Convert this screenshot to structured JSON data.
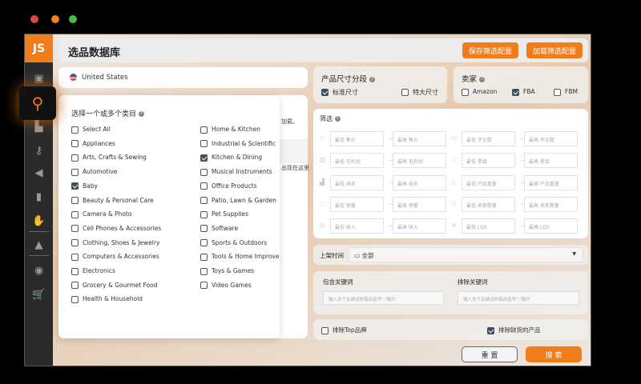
{
  "window": {
    "controls": {
      "close": "#e0443e",
      "minimize": "#f0811e",
      "maximize": "#4cb84c"
    }
  },
  "logo": "JS",
  "sidebar": {
    "icons": [
      "briefcase-icon",
      "search-icon",
      "factory-icon",
      "key-icon",
      "megaphone-icon",
      "bar-chart-icon",
      "hand-gift-icon",
      "graduation-cap-icon",
      "chrome-icon",
      "cart-icon"
    ],
    "active": "search-icon"
  },
  "header": {
    "title": "选品数据库",
    "save_label": "保存筛选配置",
    "load_label": "加载筛选配置"
  },
  "country": {
    "flag": "us-flag-icon",
    "value": "United States"
  },
  "background_text": {
    "line1": "加载。",
    "line2": "出现在这里"
  },
  "categories": {
    "title": "选择一个或多个类目",
    "left": [
      {
        "label": "Select All",
        "checked": false
      },
      {
        "label": "Appliances",
        "checked": false
      },
      {
        "label": "Arts, Crafts & Sewing",
        "checked": false
      },
      {
        "label": "Automotive",
        "checked": false
      },
      {
        "label": "Baby",
        "checked": true
      },
      {
        "label": "Beauty & Personal Care",
        "checked": false
      },
      {
        "label": "Camera & Photo",
        "checked": false
      },
      {
        "label": "Cell Phones & Accessories",
        "checked": false
      },
      {
        "label": "Clothing, Shoes & Jewelry",
        "checked": false
      },
      {
        "label": "Computers & Accessories",
        "checked": false
      },
      {
        "label": "Electronics",
        "checked": false
      },
      {
        "label": "Grocery & Gourmet Food",
        "checked": false
      },
      {
        "label": "Health & Household",
        "checked": false
      }
    ],
    "right": [
      {
        "label": "Home & Kitchen",
        "checked": false
      },
      {
        "label": "Industrial & Scientific",
        "checked": false
      },
      {
        "label": "Kitchen & Dining",
        "checked": true
      },
      {
        "label": "Musical Instruments",
        "checked": false
      },
      {
        "label": "Office Products",
        "checked": false
      },
      {
        "label": "Patio, Lawn & Garden",
        "checked": false
      },
      {
        "label": "Pet Supplies",
        "checked": false
      },
      {
        "label": "Software",
        "checked": false
      },
      {
        "label": "Sports & Outdoors",
        "checked": false
      },
      {
        "label": "Tools & Home Improvement",
        "checked": false
      },
      {
        "label": "Toys & Games",
        "checked": false
      },
      {
        "label": "Video Games",
        "checked": false
      }
    ]
  },
  "size": {
    "title": "产品尺寸分段",
    "options": [
      {
        "label": "标准尺寸",
        "checked": true
      },
      {
        "label": "特大尺寸",
        "checked": false
      }
    ]
  },
  "seller": {
    "title": "卖家",
    "options": [
      {
        "label": "Amazon",
        "checked": false
      },
      {
        "label": "FBA",
        "checked": true
      },
      {
        "label": "FBM",
        "checked": false
      }
    ]
  },
  "filters": {
    "title": "筛选",
    "rows": [
      {
        "icon": "tag-icon",
        "min": "最低 售价",
        "max": "最高 售价"
      },
      {
        "icon": "comment-icon",
        "min": "最低 评论数",
        "max": "最高 评论数"
      },
      {
        "icon": "money-bag-icon",
        "min": "最低 毛利润",
        "max": "最高 毛利润"
      },
      {
        "icon": "star-icon",
        "min": "最低 星级",
        "max": "最高 星级"
      },
      {
        "icon": "rank-icon",
        "min": "最低 排名",
        "max": "最高 排名"
      },
      {
        "icon": "weight-icon",
        "min": "最低 产品重量",
        "max": "最高 产品重量"
      },
      {
        "icon": "sales-icon",
        "min": "最低 销量",
        "max": "最高 销量"
      },
      {
        "icon": "users-icon",
        "min": "最低 卖家数量",
        "max": "最高 卖家数量"
      },
      {
        "icon": "revenue-icon",
        "min": "最低 收入",
        "max": "最高 收入"
      },
      {
        "icon": "lqs-icon",
        "min": "最低 LQS",
        "max": "最高 LQS"
      }
    ]
  },
  "date": {
    "label": "上架时间",
    "value": "全部"
  },
  "keywords": {
    "include_label": "包含关键词",
    "include_placeholder": "输入多个关键词时需用逗号\",\"隔开",
    "exclude_label": "排除关键词",
    "exclude_placeholder": "输入多个关键词时需用逗号\",\"隔开"
  },
  "options": {
    "exclude_top": {
      "label": "排除Top品牌",
      "checked": false
    },
    "exclude_oos": {
      "label": "排除缺货的产品",
      "checked": true
    }
  },
  "actions": {
    "reset": "重 置",
    "search": "搜 索"
  },
  "colors": {
    "accent": "#f07d1a",
    "sidebar": "#2b2b2b"
  }
}
